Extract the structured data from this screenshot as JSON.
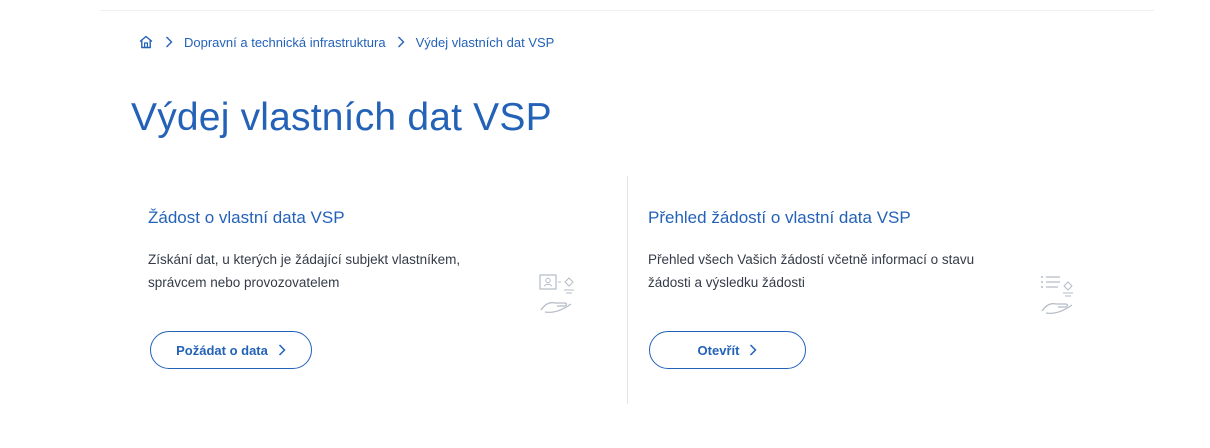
{
  "breadcrumb": {
    "home_icon": "home-icon",
    "items": [
      "Dopravní a technická infrastruktura",
      "Výdej vlastních dat VSP"
    ]
  },
  "page": {
    "title": "Výdej vlastních dat VSP"
  },
  "cards": [
    {
      "title": "Žádost o vlastní data VSP",
      "description": "Získání dat, u kterých je žádající subjekt vlastníkem, správcem nebo provozovatelem",
      "button_label": "Požádat o data",
      "icon": "data-request-hand-icon"
    },
    {
      "title": "Přehled žádostí o vlastní data VSP",
      "description": "Přehled všech Vašich žádostí včetně informací o stavu žádosti a výsledku žádosti",
      "button_label": "Otevřít",
      "icon": "list-request-hand-icon"
    }
  ],
  "colors": {
    "accent": "#2462b8",
    "text": "#333c48",
    "illustration": "#b5bcc6"
  }
}
